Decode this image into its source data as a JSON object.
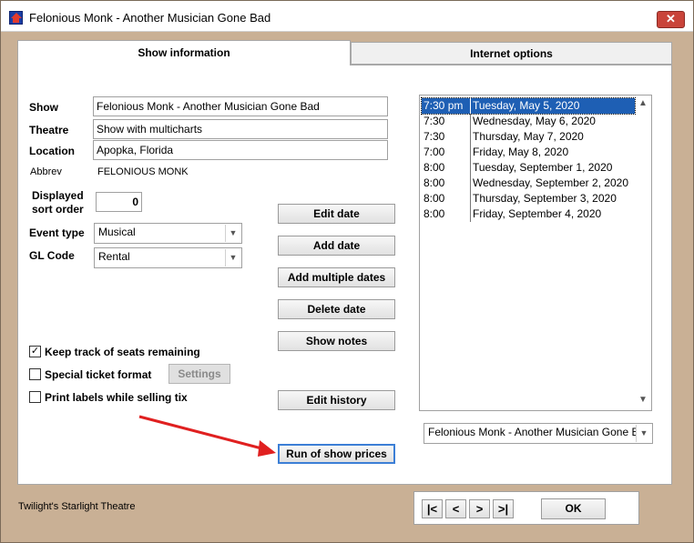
{
  "window": {
    "title": "Felonious Monk - Another Musician Gone Bad",
    "close_glyph": "✕"
  },
  "tabs": [
    {
      "label": "Show information"
    },
    {
      "label": "Internet options"
    }
  ],
  "form": {
    "show_label": "Show",
    "show_value": "Felonious Monk - Another Musician Gone Bad",
    "theatre_label": "Theatre",
    "theatre_value": "Show with multicharts",
    "location_label": "Location",
    "location_value": "Apopka, Florida",
    "abbrev_label": "Abbrev",
    "abbrev_value": "FELONIOUS MONK",
    "sort_label_1": "Displayed",
    "sort_label_2": "sort order",
    "sort_value": "0",
    "event_type_label": "Event type",
    "event_type_value": "Musical",
    "gl_code_label": "GL Code",
    "gl_code_value": "Rental"
  },
  "checkboxes": {
    "keep_track": {
      "label": "Keep track of seats remaining",
      "checked": true,
      "mark": "✓"
    },
    "special_ticket": {
      "label": "Special ticket format",
      "checked": false
    },
    "print_labels": {
      "label": "Print labels while selling tix",
      "checked": false
    },
    "settings_button": "Settings"
  },
  "buttons": {
    "edit_date": "Edit date",
    "add_date": "Add date",
    "add_multiple": "Add multiple dates",
    "delete_date": "Delete date",
    "show_notes": "Show notes",
    "edit_history": "Edit history",
    "run_prices": "Run of show prices"
  },
  "dates": [
    {
      "time": "7:30 pm",
      "date": "Tuesday, May 5, 2020",
      "selected": true
    },
    {
      "time": "7:30",
      "date": "Wednesday, May 6, 2020",
      "selected": false
    },
    {
      "time": "7:30",
      "date": "Thursday, May 7, 2020",
      "selected": false
    },
    {
      "time": "7:00",
      "date": "Friday, May 8, 2020",
      "selected": false
    },
    {
      "time": "8:00",
      "date": "Tuesday, September 1, 2020",
      "selected": false
    },
    {
      "time": "8:00",
      "date": "Wednesday, September 2, 2020",
      "selected": false
    },
    {
      "time": "8:00",
      "date": "Thursday, September 3, 2020",
      "selected": false
    },
    {
      "time": "8:00",
      "date": "Friday, September 4, 2020",
      "selected": false
    }
  ],
  "show_select": {
    "value": "Felonious Monk - Another Musician Gone Bad"
  },
  "nav": {
    "first": "|<",
    "prev": "<",
    "next": ">",
    "last": ">|",
    "ok": "OK"
  },
  "footer": {
    "venue": "Twilight's Starlight Theatre"
  },
  "colors": {
    "window_bg": "#c9b095",
    "selection": "#1e5fb4",
    "annotation_arrow": "#e02020"
  },
  "icons": {
    "close": "close-icon",
    "app": "theatre-app-icon",
    "dropdown": "chevron-down-icon",
    "annotation": "red-arrow-annotation"
  }
}
